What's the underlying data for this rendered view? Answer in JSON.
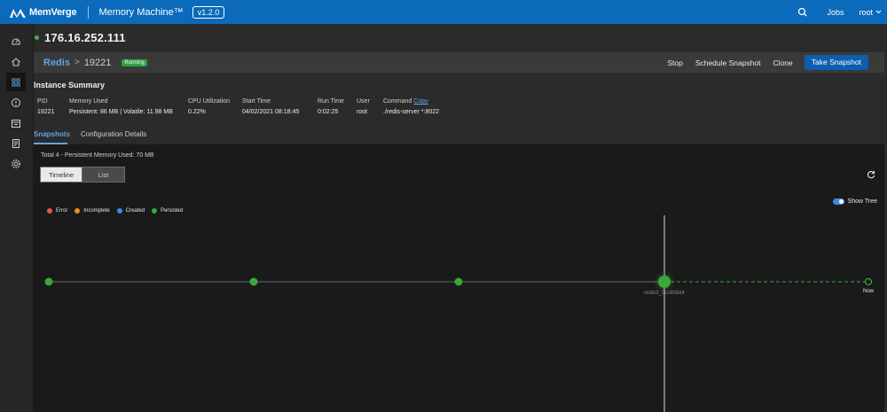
{
  "topbar": {
    "brand": "MemVerge",
    "product": "Memory Machine™",
    "version": "v1.2.0",
    "jobs_label": "Jobs",
    "user_label": "root",
    "color": "#0b6aba"
  },
  "sidebar": {
    "items": [
      {
        "icon": "dashboard-icon"
      },
      {
        "icon": "home-icon"
      },
      {
        "icon": "apps-grid-icon",
        "active": true
      },
      {
        "icon": "alert-icon"
      },
      {
        "icon": "calendar-icon"
      },
      {
        "icon": "report-icon"
      },
      {
        "icon": "settings-icon"
      }
    ]
  },
  "header": {
    "host_ip": "176.16.252.111",
    "status_color": "#3cb043"
  },
  "breadcrumb": {
    "app": "Redis",
    "separator": ">",
    "instance": "19221",
    "status": "Running"
  },
  "actions": {
    "stop": "Stop",
    "schedule": "Schedule Snapshot",
    "clone": "Clone",
    "take": "Take Snapshot"
  },
  "summary": {
    "title": "Instance Summary",
    "pid_label": "PID",
    "pid": "19221",
    "memory_label": "Memory Used",
    "memory": "Persistent: 86 MB | Volatile: 11.98 MB",
    "cpu_label": "CPU Utilization",
    "cpu": "0.22%",
    "start_label": "Start Time",
    "start": "04/02/2021 08:18:45",
    "run_label": "Run Time",
    "run": "0:02:25",
    "user_label": "User",
    "user": "root",
    "command_label": "Command",
    "copy_label": "Copy",
    "command": "./redis-server *:8022"
  },
  "tabs": {
    "snapshots": "Snapshots",
    "config": "Configuration Details"
  },
  "panel": {
    "total": "Total 4 - Persistent Memory Used: 70 MB",
    "timeline_btn": "Timeline",
    "list_btn": "List",
    "show_tree": "Show Tree",
    "legend": {
      "error": "Error",
      "incomplete": "Incomplete",
      "created": "Created",
      "persisted": "Persisted"
    },
    "colors": {
      "error": "#e8554e",
      "incomplete": "#f28c28",
      "created": "#3d8be0",
      "persisted": "#39a83a"
    },
    "selected_snapshot_label": "redis3_2cc8b5d4",
    "now_label": "Now"
  }
}
